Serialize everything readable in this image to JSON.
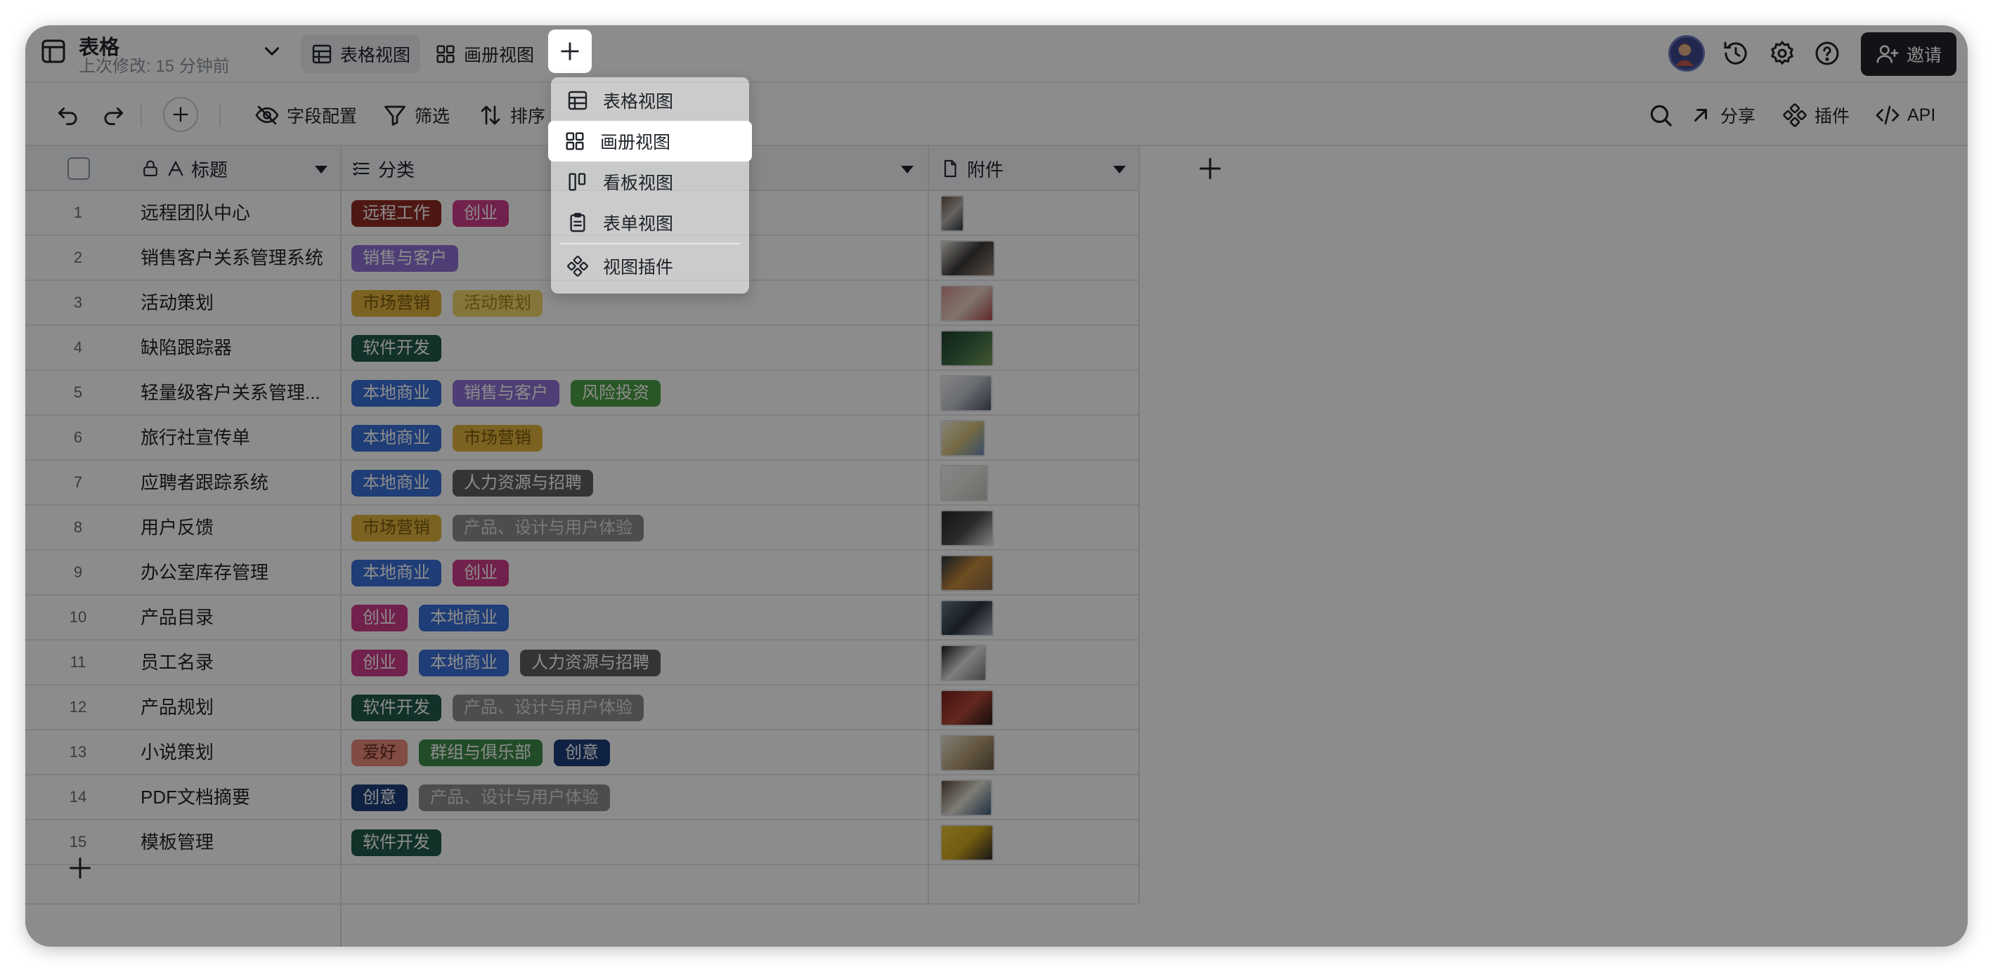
{
  "header": {
    "title": "表格",
    "subtitle": "上次修改: 15 分钟前",
    "tabs": [
      {
        "label": "表格视图",
        "icon": "table-grid-icon"
      },
      {
        "label": "画册视图",
        "icon": "gallery-grid-icon"
      }
    ],
    "invite_label": "邀请"
  },
  "toolbar": {
    "fields_label": "字段配置",
    "filter_label": "筛选",
    "sort_label": "排序",
    "share_label": "分享",
    "plugins_label": "插件",
    "api_label": "API"
  },
  "columns": {
    "title": "标题",
    "category": "分类",
    "attachment": "附件"
  },
  "rows": [
    {
      "num": "1",
      "title": "远程团队中心",
      "tags": [
        {
          "text": "远程工作",
          "color": "#8e2a23"
        },
        {
          "text": "创业",
          "color": "#d03b8a"
        }
      ],
      "thumb_w": 34,
      "thumb_colors": [
        "#6b5448",
        "#b9b3ad",
        "#2f3a44"
      ]
    },
    {
      "num": "2",
      "title": "销售客户关系管理系统",
      "tags": [
        {
          "text": "销售与客户",
          "color": "#8e72d6"
        }
      ],
      "thumb_w": 78,
      "thumb_colors": [
        "#e7e3de",
        "#3b3836",
        "#9a8a7c"
      ]
    },
    {
      "num": "3",
      "title": "活动策划",
      "tags": [
        {
          "text": "市场营销",
          "color": "#e0b23c",
          "fg": "#7a5b10"
        },
        {
          "text": "活动策划",
          "color": "#f0d76a",
          "fg": "#a08620"
        }
      ],
      "thumb_w": 76,
      "thumb_colors": [
        "#d88f8f",
        "#ead4c8",
        "#b44c4c"
      ]
    },
    {
      "num": "4",
      "title": "缺陷跟踪器",
      "tags": [
        {
          "text": "软件开发",
          "color": "#1f5a4c"
        }
      ],
      "thumb_w": 76,
      "thumb_colors": [
        "#1e3f2c",
        "#3c6b46",
        "#7a9e5c"
      ]
    },
    {
      "num": "5",
      "title": "轻量级客户关系管理...",
      "tags": [
        {
          "text": "本地商业",
          "color": "#3a6fd8"
        },
        {
          "text": "销售与客户",
          "color": "#8e72d6"
        },
        {
          "text": "风险投资",
          "color": "#4c9e45"
        }
      ],
      "thumb_w": 74,
      "thumb_colors": [
        "#f2f2f2",
        "#bfc4cc",
        "#4a5568"
      ]
    },
    {
      "num": "6",
      "title": "旅行社宣传单",
      "tags": [
        {
          "text": "本地商业",
          "color": "#3a6fd8"
        },
        {
          "text": "市场营销",
          "color": "#e0b23c",
          "fg": "#7a5b10"
        }
      ],
      "thumb_w": 64,
      "thumb_colors": [
        "#f4efe3",
        "#d8c37a",
        "#6c8fbf"
      ]
    },
    {
      "num": "7",
      "title": "应聘者跟踪系统",
      "tags": [
        {
          "text": "本地商业",
          "color": "#3a6fd8"
        },
        {
          "text": "人力资源与招聘",
          "color": "#5d5f63"
        }
      ],
      "thumb_w": 68,
      "thumb_colors": [
        "#f7f7f5",
        "#e5e3de",
        "#c9c5bd"
      ]
    },
    {
      "num": "8",
      "title": "用户反馈",
      "tags": [
        {
          "text": "市场营销",
          "color": "#e0b23c",
          "fg": "#7a5b10"
        },
        {
          "text": "产品、设计与用户体验",
          "color": "#8b8d90",
          "fg": "#dcdcdc"
        }
      ],
      "thumb_w": 76,
      "thumb_colors": [
        "#2a2a2a",
        "#4a4a4a",
        "#e8e8e8"
      ]
    },
    {
      "num": "9",
      "title": "办公室库存管理",
      "tags": [
        {
          "text": "本地商业",
          "color": "#3a6fd8"
        },
        {
          "text": "创业",
          "color": "#d03b8a"
        }
      ],
      "thumb_w": 76,
      "thumb_colors": [
        "#2c3440",
        "#c98c3c",
        "#8a6a4a"
      ]
    },
    {
      "num": "10",
      "title": "产品目录",
      "tags": [
        {
          "text": "创业",
          "color": "#d03b8a"
        },
        {
          "text": "本地商业",
          "color": "#3a6fd8"
        }
      ],
      "thumb_w": 76,
      "thumb_colors": [
        "#6d7a8a",
        "#2a3340",
        "#b8c0ca"
      ]
    },
    {
      "num": "11",
      "title": "员工名录",
      "tags": [
        {
          "text": "创业",
          "color": "#d03b8a"
        },
        {
          "text": "本地商业",
          "color": "#3a6fd8"
        },
        {
          "text": "人力资源与招聘",
          "color": "#5d5f63"
        }
      ],
      "thumb_w": 66,
      "thumb_colors": [
        "#1d1d1d",
        "#e6e6e6",
        "#7a7a7a"
      ]
    },
    {
      "num": "12",
      "title": "产品规划",
      "tags": [
        {
          "text": "软件开发",
          "color": "#1f5a4c"
        },
        {
          "text": "产品、设计与用户体验",
          "color": "#8b8d90",
          "fg": "#dcdcdc"
        }
      ],
      "thumb_w": 76,
      "thumb_colors": [
        "#7a1d1d",
        "#b54a3a",
        "#2a1a1a"
      ]
    },
    {
      "num": "13",
      "title": "小说策划",
      "tags": [
        {
          "text": "爱好",
          "color": "#e98a7c",
          "fg": "#6a2a22"
        },
        {
          "text": "群组与俱乐部",
          "color": "#3c8a48"
        },
        {
          "text": "创意",
          "color": "#1e3f7a"
        }
      ],
      "thumb_w": 78,
      "thumb_colors": [
        "#e8e2d4",
        "#b9a27a",
        "#6c5a44"
      ]
    },
    {
      "num": "14",
      "title": "PDF文档摘要",
      "tags": [
        {
          "text": "创意",
          "color": "#1e3f7a"
        },
        {
          "text": "产品、设计与用户体验",
          "color": "#8b8d90",
          "fg": "#dcdcdc"
        }
      ],
      "thumb_w": 74,
      "thumb_colors": [
        "#5a4a3a",
        "#e8e2d8",
        "#3a5a7a"
      ]
    },
    {
      "num": "15",
      "title": "模板管理",
      "tags": [
        {
          "text": "软件开发",
          "color": "#1f5a4c"
        }
      ],
      "thumb_w": 76,
      "thumb_colors": [
        "#e8c43a",
        "#d4a820",
        "#2a2a2a"
      ]
    }
  ],
  "menu": {
    "items": [
      {
        "label": "表格视图",
        "icon": "table-grid-icon"
      },
      {
        "label": "画册视图",
        "icon": "gallery-grid-icon"
      },
      {
        "label": "看板视图",
        "icon": "kanban-icon"
      },
      {
        "label": "表单视图",
        "icon": "form-clipboard-icon"
      },
      {
        "label": "视图插件",
        "icon": "plugin-icon"
      }
    ],
    "active_index": 1
  }
}
